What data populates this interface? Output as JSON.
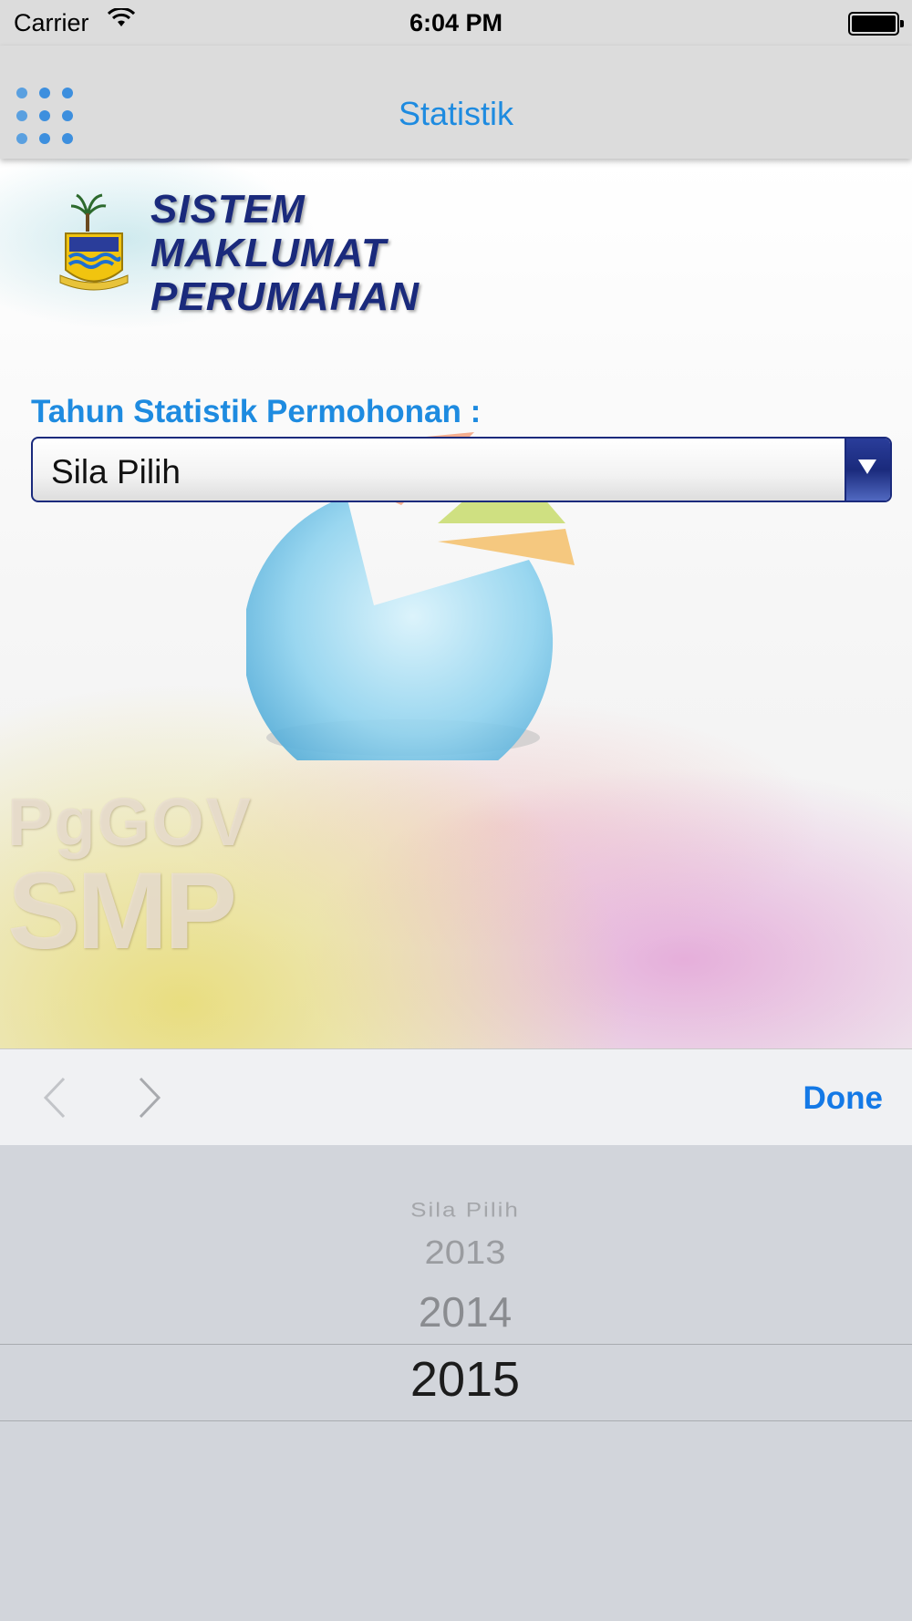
{
  "status_bar": {
    "carrier": "Carrier",
    "time": "6:04 PM"
  },
  "nav": {
    "title": "Statistik",
    "menu_icon": "grid-menu-icon"
  },
  "header": {
    "logo_line1": "SISTEM",
    "logo_line2": "MAKLUMAT",
    "logo_line3": "PERUMAHAN"
  },
  "form": {
    "label": "Tahun Statistik Permohonan :",
    "select_value": "Sila Pilih"
  },
  "watermark": {
    "line1": "PgGOV",
    "line2": "SMP"
  },
  "toolbar": {
    "done_label": "Done"
  },
  "picker": {
    "options": [
      "Sila Pilih",
      "2013",
      "2014",
      "2015"
    ],
    "selected": "2015"
  },
  "colors": {
    "accent": "#1e8be0",
    "navy": "#1a2a7c",
    "done": "#1479e6"
  }
}
